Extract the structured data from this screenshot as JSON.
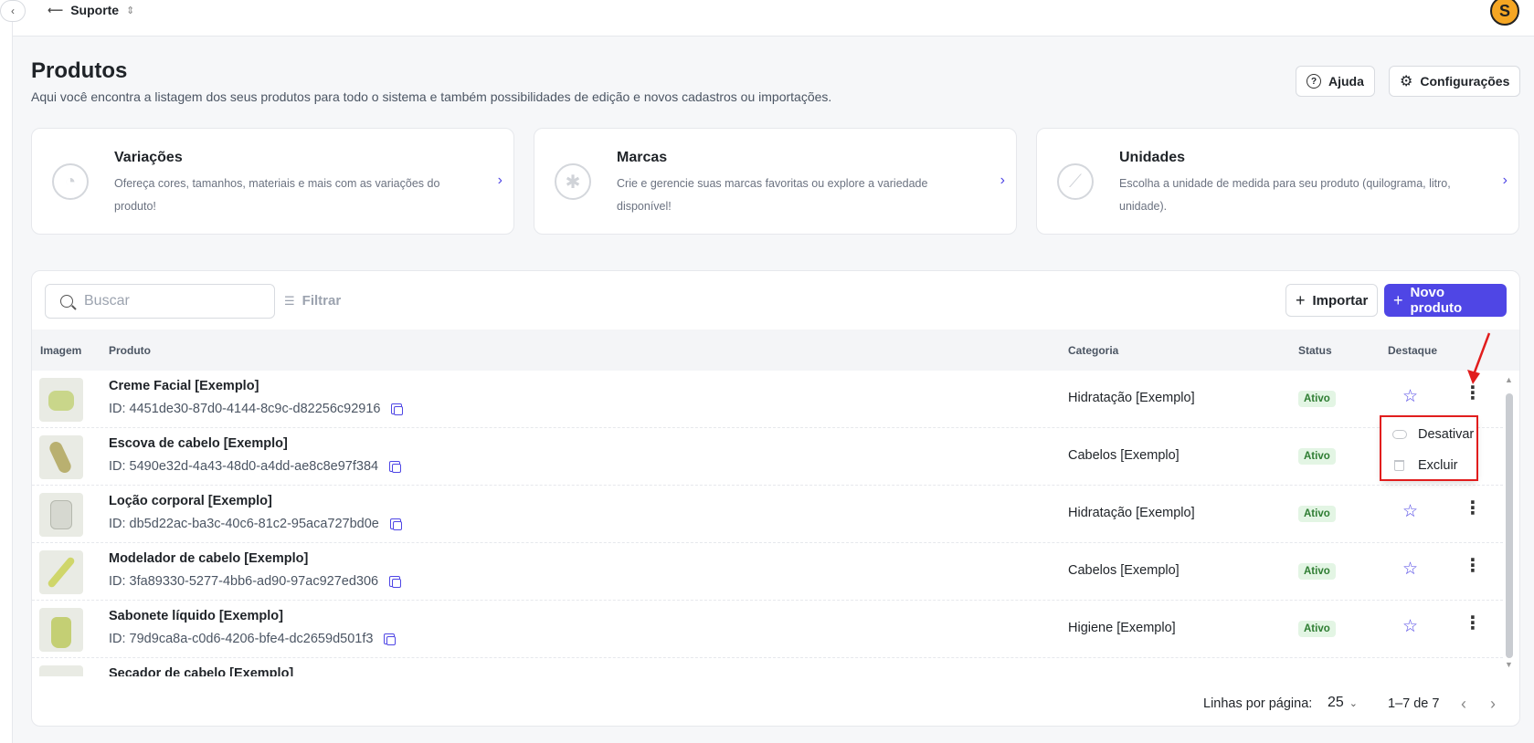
{
  "topbar": {
    "org_name": "Suporte"
  },
  "user": {
    "avatar_initial": "S"
  },
  "header": {
    "title": "Produtos",
    "subtitle": "Aqui você encontra a listagem dos seus produtos para todo o sistema e também possibilidades de edição e novos cadastros ou importações.",
    "help_label": "Ajuda",
    "config_label": "Configurações"
  },
  "cards": [
    {
      "title": "Variações",
      "description": "Ofereça cores, tamanhos, materiais e mais com as variações do produto!"
    },
    {
      "title": "Marcas",
      "description": "Crie e gerencie suas marcas favoritas ou explore a variedade disponível!"
    },
    {
      "title": "Unidades",
      "description": "Escolha a unidade de medida para seu produto (quilograma, litro, unidade)."
    }
  ],
  "toolbar": {
    "search_placeholder": "Buscar",
    "filter_label": "Filtrar",
    "import_label": "Importar",
    "new_product_label": "Novo produto"
  },
  "table": {
    "columns": {
      "image": "Imagem",
      "product": "Produto",
      "category": "Categoria",
      "status": "Status",
      "featured": "Destaque"
    },
    "rows": [
      {
        "name": "Creme Facial [Exemplo]",
        "id": "ID: 4451de30-87d0-4144-8c9c-d82256c92916",
        "category": "Hidratação [Exemplo]",
        "status": "Ativo",
        "thumb_color": "#c9d68a"
      },
      {
        "name": "Escova de cabelo [Exemplo]",
        "id": "ID: 5490e32d-4a43-48d0-a4dd-ae8c8e97f384",
        "category": "Cabelos [Exemplo]",
        "status": "Ativo",
        "thumb_color": "#b9b070"
      },
      {
        "name": "Loção corporal [Exemplo]",
        "id": "ID: db5d22ac-ba3c-40c6-81c2-95aca727bd0e",
        "category": "Hidratação [Exemplo]",
        "status": "Ativo",
        "thumb_color": "#d6d8d0"
      },
      {
        "name": "Modelador de cabelo [Exemplo]",
        "id": "ID: 3fa89330-5277-4bb6-ad90-97ac927ed306",
        "category": "Cabelos [Exemplo]",
        "status": "Ativo",
        "thumb_color": "#cfd66a"
      },
      {
        "name": "Sabonete líquido [Exemplo]",
        "id": "ID: 79d9ca8a-c0d6-4206-bfe4-dc2659d501f3",
        "category": "Higiene [Exemplo]",
        "status": "Ativo",
        "thumb_color": "#c4cf74"
      },
      {
        "name": "Secador de cabelo [Exemplo]",
        "id": "",
        "category": "",
        "status": "",
        "thumb_color": "#d8d8d8"
      }
    ]
  },
  "row_menu": {
    "deactivate_label": "Desativar",
    "delete_label": "Excluir"
  },
  "pagination": {
    "rows_per_page_label": "Linhas por página:",
    "rows_per_page": "25",
    "range": "1–7 de 7"
  },
  "colors": {
    "accent": "#4f46e5",
    "active_badge_bg": "#e3f5e4",
    "active_badge_text": "#2e7d32",
    "annotation_red": "#e11d1d"
  },
  "icons": {
    "help": "help-circle-icon",
    "config": "gear-icon",
    "variations": "palette-icon",
    "brands": "tag-icon",
    "units": "ruler-icon",
    "search": "search-icon",
    "filter": "filter-icon",
    "copy": "copy-icon",
    "featured": "star-outline-icon",
    "row_actions": "kebab-icon",
    "deactivate": "toggle-icon",
    "delete": "trash-icon"
  }
}
